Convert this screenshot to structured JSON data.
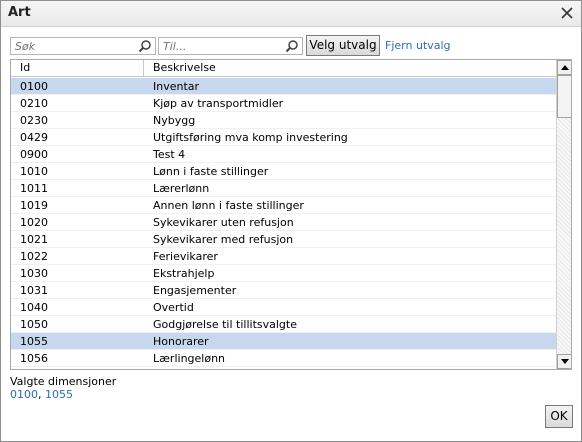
{
  "dialog": {
    "title": "Art"
  },
  "filters": {
    "search_placeholder": "Søk",
    "to_placeholder": "Til...",
    "select_button": "Velg utvalg",
    "clear_link": "Fjern utvalg"
  },
  "table": {
    "columns": [
      "Id",
      "Beskrivelse"
    ],
    "rows": [
      {
        "id": "0100",
        "desc": "Inventar",
        "selected": true
      },
      {
        "id": "0210",
        "desc": "Kjøp av transportmidler",
        "selected": false
      },
      {
        "id": "0230",
        "desc": "Nybygg",
        "selected": false
      },
      {
        "id": "0429",
        "desc": "Utgiftsføring mva komp investering",
        "selected": false
      },
      {
        "id": "0900",
        "desc": "Test 4",
        "selected": false
      },
      {
        "id": "1010",
        "desc": "Lønn i faste stillinger",
        "selected": false
      },
      {
        "id": "1011",
        "desc": "Lærerlønn",
        "selected": false
      },
      {
        "id": "1019",
        "desc": "Annen lønn i faste stillinger",
        "selected": false
      },
      {
        "id": "1020",
        "desc": "Sykevikarer uten refusjon",
        "selected": false
      },
      {
        "id": "1021",
        "desc": "Sykevikarer med refusjon",
        "selected": false
      },
      {
        "id": "1022",
        "desc": "Ferievikarer",
        "selected": false
      },
      {
        "id": "1030",
        "desc": "Ekstrahjelp",
        "selected": false
      },
      {
        "id": "1031",
        "desc": "Engasjementer",
        "selected": false
      },
      {
        "id": "1040",
        "desc": "Overtid",
        "selected": false
      },
      {
        "id": "1050",
        "desc": "Godgjørelse til tillitsvalgte",
        "selected": false
      },
      {
        "id": "1055",
        "desc": "Honorarer",
        "selected": true
      },
      {
        "id": "1056",
        "desc": "Lærlingelønn",
        "selected": false
      }
    ]
  },
  "selection": {
    "label": "Valgte dimensjoner",
    "values": [
      "0100",
      "1055"
    ],
    "separator": ", "
  },
  "footer": {
    "ok_label": "OK"
  },
  "colors": {
    "selected_row": "#c7d7ee",
    "link": "#2a6cb6"
  },
  "icons": {
    "close": "close-icon",
    "search": "search-icon"
  }
}
